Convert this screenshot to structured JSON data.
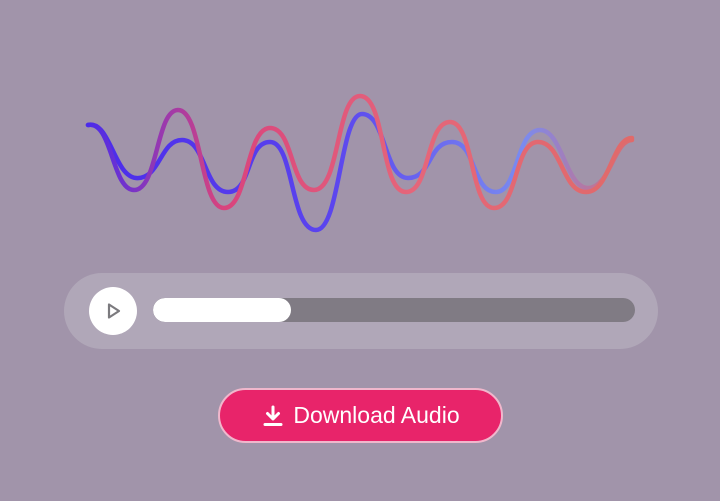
{
  "player": {
    "progress": 0.287
  },
  "download_button": {
    "label": "Download Audio",
    "icon": "download-icon"
  },
  "waveform": {
    "icon": "sound-wave",
    "gradient_colors": [
      "#4b2bea",
      "#d9447d",
      "#e5667a",
      "#7a8bf0"
    ]
  },
  "colors": {
    "background": "#a194aa",
    "accent": "#e8246a",
    "player_background": "#b0a7b8",
    "track": "#807b84",
    "fill": "#ffffff"
  }
}
